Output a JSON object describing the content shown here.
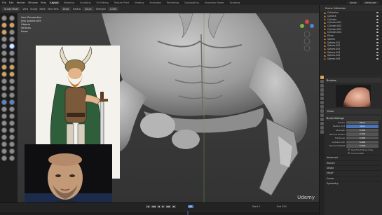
{
  "topbar": {
    "menus": [
      "File",
      "Edit",
      "Render",
      "Window",
      "Help"
    ],
    "workspaces": [
      "Layout",
      "Modeling",
      "Sculpting",
      "UV Editing",
      "Texture Paint",
      "Shading",
      "Animation",
      "Rendering",
      "Compositing",
      "Geometry Nodes",
      "Scripting"
    ],
    "active_workspace": "Layout",
    "scene": "Scene",
    "view_layer": "ViewLayer"
  },
  "header": {
    "mode": "Sculpt Mode",
    "items": [
      "View",
      "Sculpt",
      "Mask",
      "Face Sets"
    ],
    "brush": "Draw",
    "radius_label": "Radius",
    "radius_value": "48 px",
    "strength_label": "Strength",
    "strength_value": "0.500"
  },
  "viewport": {
    "info_line1": "User Perspective",
    "info_line2": "(60) Sphere.009",
    "info_line3": "Objects",
    "info_line4": "Vertices",
    "info_line5": "Faces",
    "watermark": "Udemy"
  },
  "timeline": {
    "buttons": [
      "|◀",
      "◀◀",
      "◀",
      "▶",
      "▶▶",
      "▶|"
    ],
    "current_frame": "60",
    "start_label": "Start",
    "start_value": "1",
    "end_label": "End",
    "end_value": "250"
  },
  "outliner": {
    "title": "Scene Collection",
    "items": [
      "Collection",
      "Camera",
      "Cylinder",
      "Cylinder.001",
      "Cylinder.002",
      "Cylinder.003",
      "Cylinder.004",
      "Plane",
      "Sphere",
      "Sphere.001",
      "Sphere.002",
      "Sphere.003",
      "Sphere.004",
      "Sphere.005",
      "Sphere.009"
    ]
  },
  "properties": {
    "tool_label": "Brushes",
    "brush_name": "Draw",
    "settings_header": "Brush Settings",
    "rows": [
      {
        "label": "Radius",
        "value": "48 px",
        "highlight": false
      },
      {
        "label": "Radius Unit",
        "value": "View",
        "highlight": true
      },
      {
        "label": "Strength",
        "value": "0.500",
        "highlight": false
      },
      {
        "label": "Normal Radius",
        "value": "0.500",
        "highlight": false
      },
      {
        "label": "Hardness",
        "value": "0.000",
        "highlight": false
      },
      {
        "label": "Autosmooth",
        "value": "0.000",
        "highlight": false
      },
      {
        "label": "Normal Weight",
        "value": "0.000",
        "highlight": false
      }
    ],
    "checks": [
      "Use Front Faces Only",
      "Accumulate"
    ],
    "sections": [
      "Advanced",
      "Texture",
      "Stroke",
      "Falloff",
      "Cursor"
    ],
    "tail": "Symmetry"
  },
  "colors": {
    "accent_blue": "#4b74b8",
    "accent_orange": "#d9a25a",
    "sculpt_clay": "#a8a8a8"
  }
}
